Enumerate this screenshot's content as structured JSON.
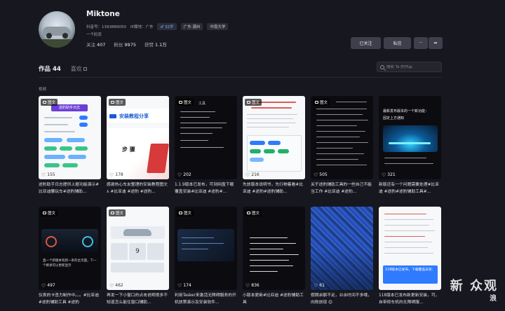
{
  "profile": {
    "name": "Miktone",
    "douyin_id": "抖音号：1393889050",
    "ip": "IP属地：广东",
    "tags": [
      "♂ 32岁",
      "广东·潮州",
      "中南大学"
    ],
    "bio": "一个码农",
    "stats": [
      {
        "label": "关注",
        "value": "407"
      },
      {
        "label": "粉丝",
        "value": "9975"
      },
      {
        "label": "获赞",
        "value": "1.1万"
      }
    ]
  },
  "actions": {
    "follow": "已关注",
    "message": "私信",
    "more": "···",
    "share": "➦"
  },
  "tabs": {
    "works": "作品 44",
    "likes": "喜欢"
  },
  "search": {
    "placeholder": "搜索 Ta 的作品"
  },
  "section": {
    "label": "视频"
  },
  "badge_label": "图文",
  "cards": [
    {
      "likes": "155",
      "caption": "途豹助手日志提供上据功能演示#比亚迪腰玩车#途豹辅助..."
    },
    {
      "likes": "178",
      "caption": "感谢热心车友整理的安装教程图文 ⅄ #比亚迪 #途豹 #途豹..."
    },
    {
      "likes": "202",
      "caption": "1.1.9版本已发布，可到网盘下载覆盖安装#比亚迪 #途豹#..."
    },
    {
      "likes": "216",
      "caption": "先放版本说明书，先行物着看#比亚迪 #途豹#途豹辅助..."
    },
    {
      "likes": "505",
      "caption": "关于途豹辅助工具的一些自己不能当工作 #比亚迪 #途豹..."
    },
    {
      "likes": "321",
      "caption": "新版还有一个问题需要处理#比亚迪 #途豹#途豹辅助工具#..."
    },
    {
      "likes": "497",
      "caption": "仪表的卡查力制作中。。。#比亚迪 #途豹辅助工具 #途豹"
    },
    {
      "likes": "462",
      "caption": "再发一下小窗口的点击说明很多不知道怎么能住窗口辅助..."
    },
    {
      "likes": "174",
      "caption": "利用Tasker来激活无障碍服务的开机放策演示及安装软件..."
    },
    {
      "likes": "836",
      "caption": "小版本更新#比亚迪 #途豹辅助工具"
    },
    {
      "likes": "61",
      "caption": "假期余额不足，业余时间不多哦，向败放现 😊"
    },
    {
      "likes": "",
      "caption": "118版本已发布新更新安装，可，自带修车机的无障碍服..."
    }
  ],
  "thumb_text": {
    "c1_title": "途豹助手日志",
    "c2_title": "安装教程分享",
    "c2_step": "步 骤",
    "c3_title": "工具",
    "c6_head": "最新发布版本的一个新功能：",
    "c6_sub": "固定上方通知",
    "c7_cap": "直一个新版本有新一条的主页面，下一个继承可以更新显示",
    "c12_head": "118版本已发布，下载覆盖安装：",
    "watermark_main": "新 众观",
    "watermark_sub": "浪"
  },
  "colors": {
    "accent_blue": "#2f7bff",
    "green": "#1fb16b",
    "red": "#e4393c",
    "bg": "#16171f"
  }
}
